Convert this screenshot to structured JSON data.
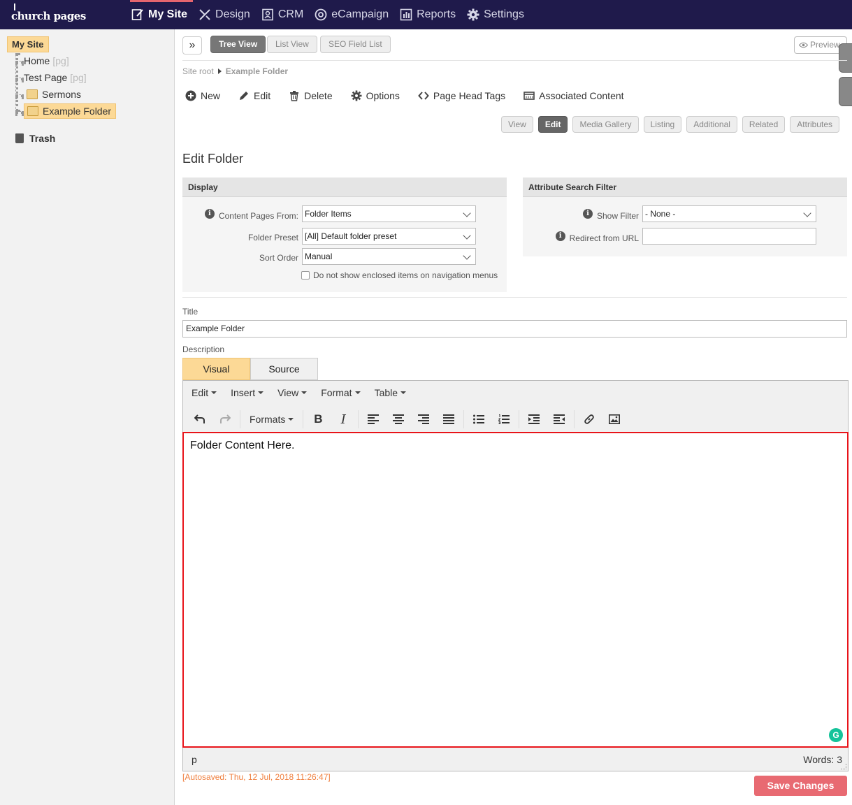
{
  "app": {
    "logo": "church pages"
  },
  "topnav": [
    {
      "label": "My Site",
      "icon": "edit-page-icon",
      "active": true
    },
    {
      "label": "Design",
      "icon": "design-tools-icon"
    },
    {
      "label": "CRM",
      "icon": "contacts-icon"
    },
    {
      "label": "eCampaign",
      "icon": "at-sign-icon"
    },
    {
      "label": "Reports",
      "icon": "bar-chart-icon"
    },
    {
      "label": "Settings",
      "icon": "gear-icon"
    }
  ],
  "sidebar": {
    "root": "My Site",
    "items": [
      {
        "label": "Home",
        "tag": "[pg]"
      },
      {
        "label": "Test Page",
        "tag": "[pg]"
      },
      {
        "label": "Sermons"
      },
      {
        "label": "Example Folder",
        "selected": true
      }
    ],
    "trash": "Trash"
  },
  "viewbar": {
    "expand": "»",
    "tree_view": "Tree View",
    "list_view": "List View",
    "seo_field_list": "SEO Field List",
    "preview": "Preview"
  },
  "breadcrumb": {
    "root": "Site root",
    "current": "Example Folder"
  },
  "actions": {
    "new": "New",
    "edit": "Edit",
    "delete": "Delete",
    "options": "Options",
    "page_head_tags": "Page Head Tags",
    "associated_content": "Associated Content"
  },
  "tabs": {
    "view": "View",
    "edit": "Edit",
    "media_gallery": "Media Gallery",
    "listing": "Listing",
    "additional": "Additional",
    "related": "Related",
    "attributes": "Attributes"
  },
  "page_title": "Edit Folder",
  "display_panel": {
    "heading": "Display",
    "content_pages_label": "Content Pages From:",
    "content_pages_value": "Folder Items",
    "folder_preset_label": "Folder Preset",
    "folder_preset_value": "[All] Default folder preset",
    "sort_order_label": "Sort Order",
    "sort_order_value": "Manual",
    "hide_nav_label": "Do not show enclosed items on navigation menus"
  },
  "attr_panel": {
    "heading": "Attribute Search Filter",
    "show_filter_label": "Show Filter",
    "show_filter_value": "- None -",
    "redirect_label": "Redirect from URL",
    "redirect_value": ""
  },
  "form": {
    "title_label": "Title",
    "title_value": "Example Folder",
    "description_label": "Description"
  },
  "editor": {
    "tab_visual": "Visual",
    "tab_source": "Source",
    "menu_edit": "Edit",
    "menu_insert": "Insert",
    "menu_view": "View",
    "menu_format": "Format",
    "menu_table": "Table",
    "formats": "Formats",
    "bold": "B",
    "italic": "I",
    "content": "Folder Content Here.",
    "path": "p",
    "words": "Words: 3",
    "grammarly": "G"
  },
  "autosave": "[Autosaved: Thu, 12 Jul, 2018 11:26:47]",
  "save_button": "Save Changes",
  "colors": {
    "topbar": "#1f1a4b",
    "active_underline": "#e5656e",
    "selection": "#fcd996",
    "editor_border": "#e8141a",
    "save_button": "#e86a72",
    "autosave_text": "#f08040"
  }
}
